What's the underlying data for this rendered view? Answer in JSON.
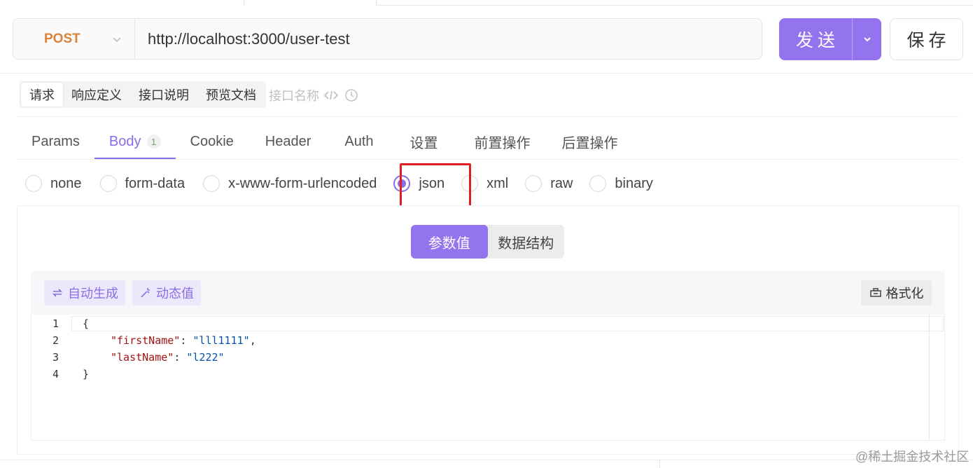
{
  "request": {
    "method": "POST",
    "url": "http://localhost:3000/user-test",
    "send_label": "发送",
    "save_label": "保存"
  },
  "sub_tabs": {
    "items": [
      "请求",
      "响应定义",
      "接口说明",
      "预览文档"
    ],
    "active": "请求",
    "name_placeholder": "接口名称"
  },
  "tabs": {
    "items": [
      "Params",
      "Body",
      "Cookie",
      "Header",
      "Auth",
      "设置",
      "前置操作",
      "后置操作"
    ],
    "active": "Body",
    "body_count": "1"
  },
  "body_types": {
    "items": [
      "none",
      "form-data",
      "x-www-form-urlencoded",
      "json",
      "xml",
      "raw",
      "binary"
    ],
    "selected": "json"
  },
  "view_toggle": {
    "items": [
      "参数值",
      "数据结构"
    ],
    "active": "参数值"
  },
  "editor": {
    "auto_generate_label": "自动生成",
    "dynamic_value_label": "动态值",
    "format_label": "格式化",
    "line_numbers": [
      "1",
      "2",
      "3",
      "4"
    ],
    "line1": "{",
    "line2_key": "\"firstName\"",
    "line2_sep": ": ",
    "line2_val": "\"lll1111\"",
    "line2_end": ",",
    "line3_key": "\"lastName\"",
    "line3_sep": ": ",
    "line3_val": "\"l222\"",
    "line4": "}"
  },
  "watermark": "@稀土掘金技术社区",
  "colors": {
    "accent": "#9373ee",
    "method": "#d9823a",
    "highlight": "#e02020"
  }
}
